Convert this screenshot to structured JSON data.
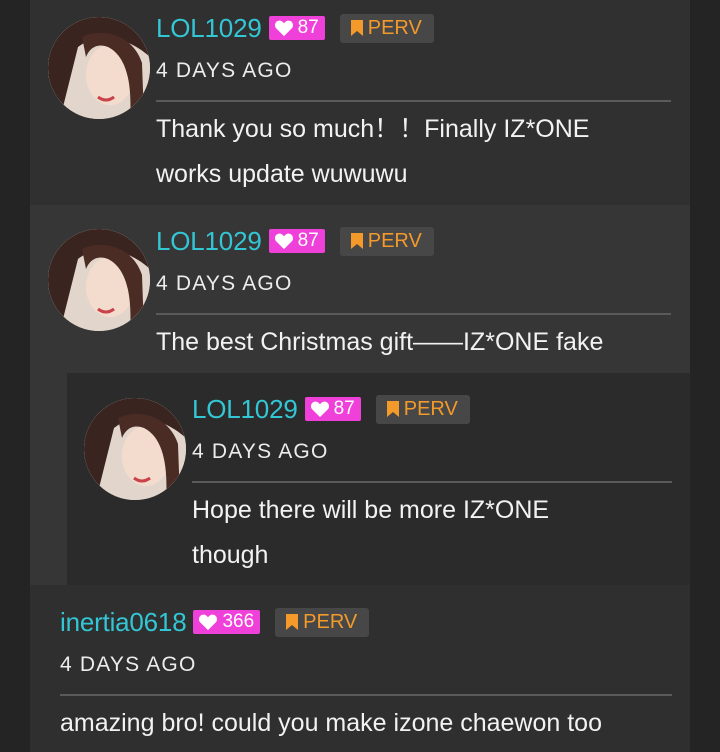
{
  "comments": [
    {
      "username": "LOL1029",
      "likes": "87",
      "badge": "PERV",
      "time": "4 DAYS AGO",
      "text_lines": [
        "Thank you so much！！Finally IZ*ONE",
        "works update wuwuwu"
      ]
    },
    {
      "username": "LOL1029",
      "likes": "87",
      "badge": "PERV",
      "time": "4 DAYS AGO",
      "text_lines": [
        "The best Christmas gift——IZ*ONE fake"
      ],
      "reply": {
        "username": "LOL1029",
        "likes": "87",
        "badge": "PERV",
        "time": "4 DAYS AGO",
        "text_lines": [
          "Hope there will be more IZ*ONE",
          "though"
        ]
      }
    },
    {
      "username": "inertia0618",
      "likes": "366",
      "badge": "PERV",
      "time": "4 DAYS AGO",
      "text_lines": [
        "amazing bro! could you make izone chaewon too"
      ]
    }
  ],
  "colors": {
    "username": "#33c6d4",
    "likes_badge": "#ef40da",
    "perv_text": "#f39a2b"
  },
  "icons": {
    "likes": "heart-icon",
    "badge": "bookmark-icon"
  }
}
